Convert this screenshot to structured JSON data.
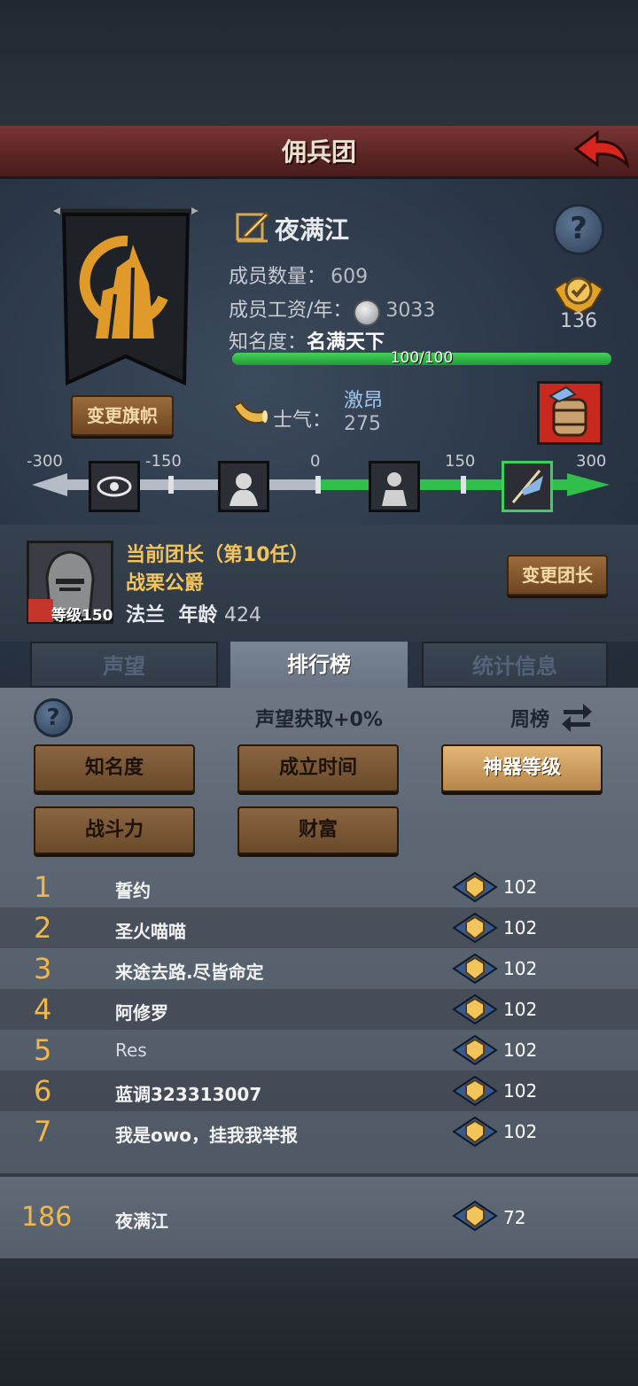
{
  "title": "佣兵团",
  "guild": {
    "name": "夜满江",
    "members_label": "成员数量：",
    "members_value": "609",
    "salary_label": "成员工资/年：",
    "salary_value": "3033",
    "fame_label": "知名度：",
    "fame_value": "名满天下",
    "fame_progress_text": "100/100",
    "fame_progress_fraction": 1.0,
    "medal_count": "136",
    "change_flag_label": "变更旗帜"
  },
  "morale": {
    "label": "士气：",
    "state": "激昂",
    "value": "275",
    "scale_ticks": [
      "-300",
      "-150",
      "0",
      "150",
      "300"
    ],
    "icons": [
      "eye-icon",
      "despair-icon",
      "calm-icon",
      "banner-charge-icon"
    ],
    "active_icon_index": 3
  },
  "leader": {
    "title": "当前团长（第10任）",
    "name": "战栗公爵",
    "level_label": "等级150",
    "origin": "法兰",
    "age_label": "年龄",
    "age_value": "424",
    "change_leader_label": "变更团长"
  },
  "tabs": [
    {
      "label": "声望",
      "active": false
    },
    {
      "label": "排行榜",
      "active": true
    },
    {
      "label": "统计信息",
      "active": false
    }
  ],
  "ranking": {
    "bonus_text": "声望获取+0%",
    "period_label": "周榜",
    "categories": [
      {
        "label": "知名度",
        "active": false
      },
      {
        "label": "成立时间",
        "active": false
      },
      {
        "label": "神器等级",
        "active": true
      },
      {
        "label": "战斗力",
        "active": false
      },
      {
        "label": "财富",
        "active": false
      }
    ],
    "rows": [
      {
        "rank": "1",
        "name": "誓约",
        "value": "102"
      },
      {
        "rank": "2",
        "name": "圣火喵喵",
        "value": "102"
      },
      {
        "rank": "3",
        "name": "来途去路.尽皆命定",
        "value": "102"
      },
      {
        "rank": "4",
        "name": "阿修罗",
        "value": "102"
      },
      {
        "rank": "5",
        "name": "Res",
        "value": "102"
      },
      {
        "rank": "6",
        "name": "蓝调323313007",
        "value": "102"
      },
      {
        "rank": "7",
        "name": "我是owo，挂我我举报",
        "value": "102"
      }
    ],
    "self_row": {
      "rank": "186",
      "name": "夜满江",
      "value": "72"
    }
  },
  "colors": {
    "title_bar": "#6a2a2a",
    "rank_number": "#f0b84a",
    "morale_green": "#2fbf4a",
    "leader_gold": "#f2c45c"
  }
}
